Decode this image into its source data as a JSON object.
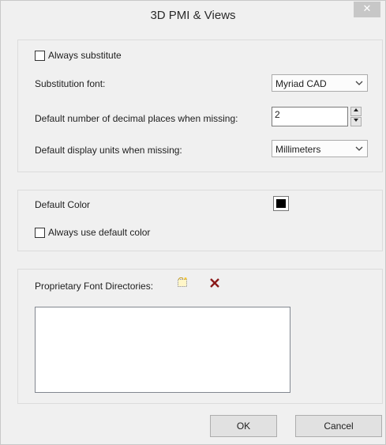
{
  "window": {
    "title": "3D PMI & Views",
    "close_glyph": "✕"
  },
  "substitution": {
    "always_substitute_label": "Always substitute",
    "always_substitute_checked": false,
    "font_label": "Substitution font:",
    "font_value": "Myriad CAD",
    "decimals_label": "Default number of decimal places when missing:",
    "decimals_value": "2",
    "units_label": "Default display units when missing:",
    "units_value": "Millimeters"
  },
  "color": {
    "default_color_label": "Default Color",
    "default_color": "#000000",
    "always_use_label": "Always use default color",
    "always_use_checked": false
  },
  "fonts": {
    "directories_label": "Proprietary Font Directories:",
    "add_icon": "new-folder-icon",
    "delete_icon": "delete-x-icon",
    "directories": []
  },
  "footer": {
    "ok_label": "OK",
    "cancel_label": "Cancel"
  }
}
